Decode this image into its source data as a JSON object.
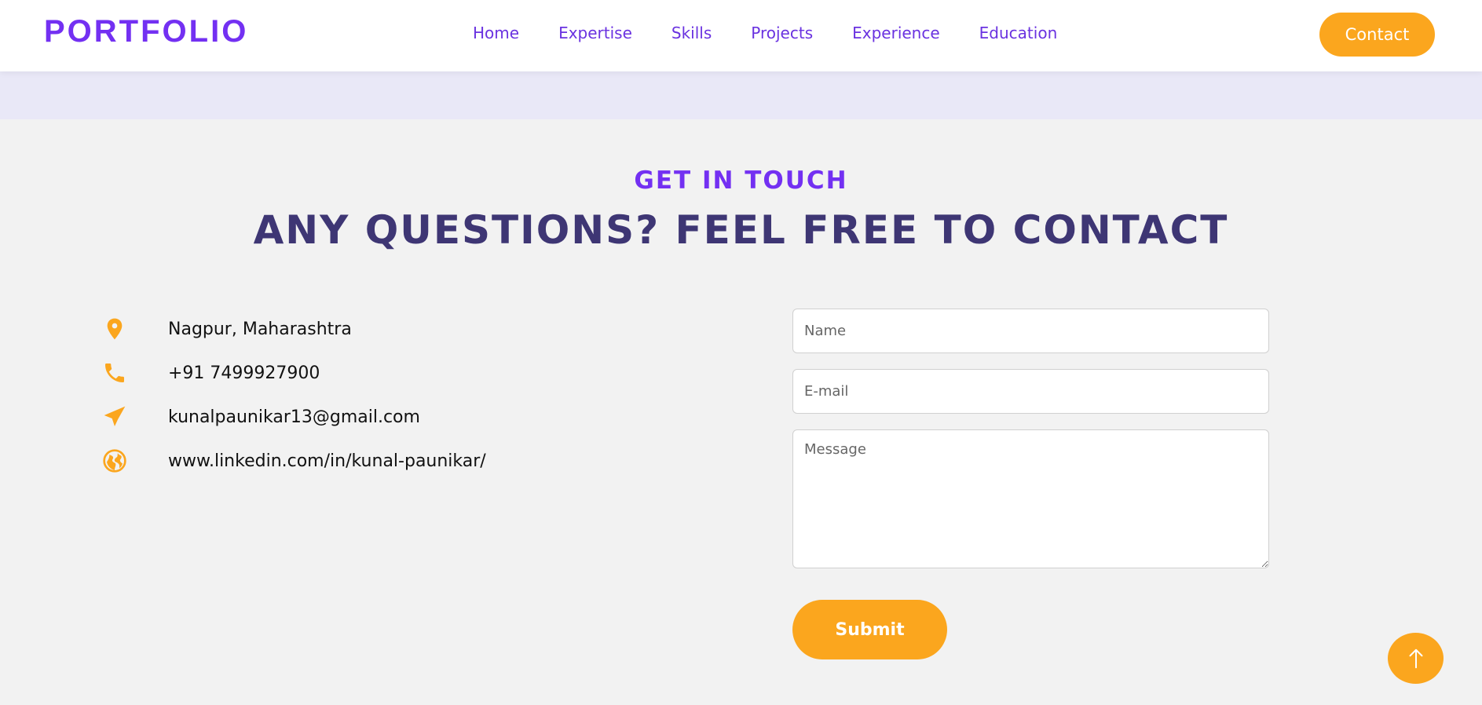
{
  "navbar": {
    "logo": "PORTFOLIO",
    "links": [
      "Home",
      "Expertise",
      "Skills",
      "Projects",
      "Experience",
      "Education"
    ],
    "contact_label": "Contact"
  },
  "section": {
    "eyebrow": "GET IN TOUCH",
    "headline": "ANY QUESTIONS? FEEL FREE TO CONTACT"
  },
  "contact_info": [
    {
      "icon": "location-pin-icon",
      "text": "Nagpur, Maharashtra"
    },
    {
      "icon": "phone-icon",
      "text": "+91 7499927900"
    },
    {
      "icon": "paper-plane-icon",
      "text": "kunalpaunikar13@gmail.com"
    },
    {
      "icon": "globe-icon",
      "text": "www.linkedin.com/in/kunal-paunikar/"
    }
  ],
  "form": {
    "name_placeholder": "Name",
    "email_placeholder": "E-mail",
    "message_placeholder": "Message",
    "submit_label": "Submit"
  },
  "colors": {
    "accent_purple": "#7330f2",
    "accent_orange": "#fba61e",
    "heading_dark": "#3e3674"
  }
}
